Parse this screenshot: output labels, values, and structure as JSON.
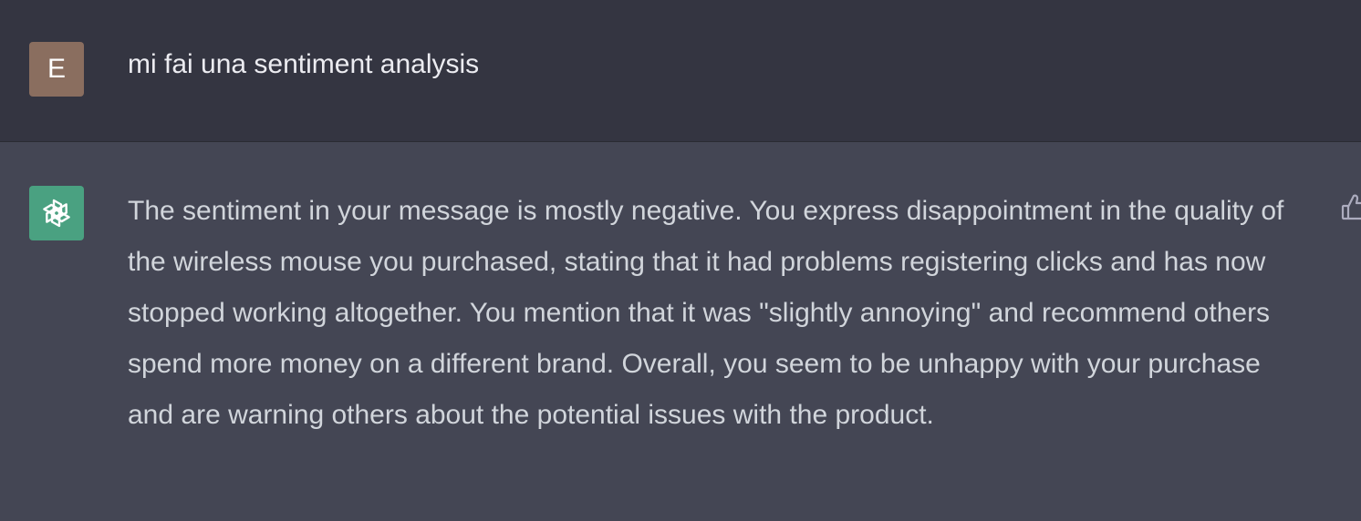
{
  "colors": {
    "user_bg": "#343541",
    "assistant_bg": "#444654",
    "user_avatar": "#8a6e5f",
    "assistant_avatar": "#4aa181"
  },
  "user": {
    "avatar_letter": "E",
    "message": "mi fai una sentiment analysis"
  },
  "assistant": {
    "avatar_icon": "openai-logo-icon",
    "message": "The sentiment in your message is mostly negative. You express disappointment in the quality of the wireless mouse you purchased, stating that it had problems registering clicks and has now stopped working altogether. You mention that it was \"slightly annoying\" and recommend others spend more money on a different brand. Overall, you seem to be unhappy with your purchase and are warning others about the potential issues with the product.",
    "feedback_icon": "thumbs-up-icon"
  }
}
